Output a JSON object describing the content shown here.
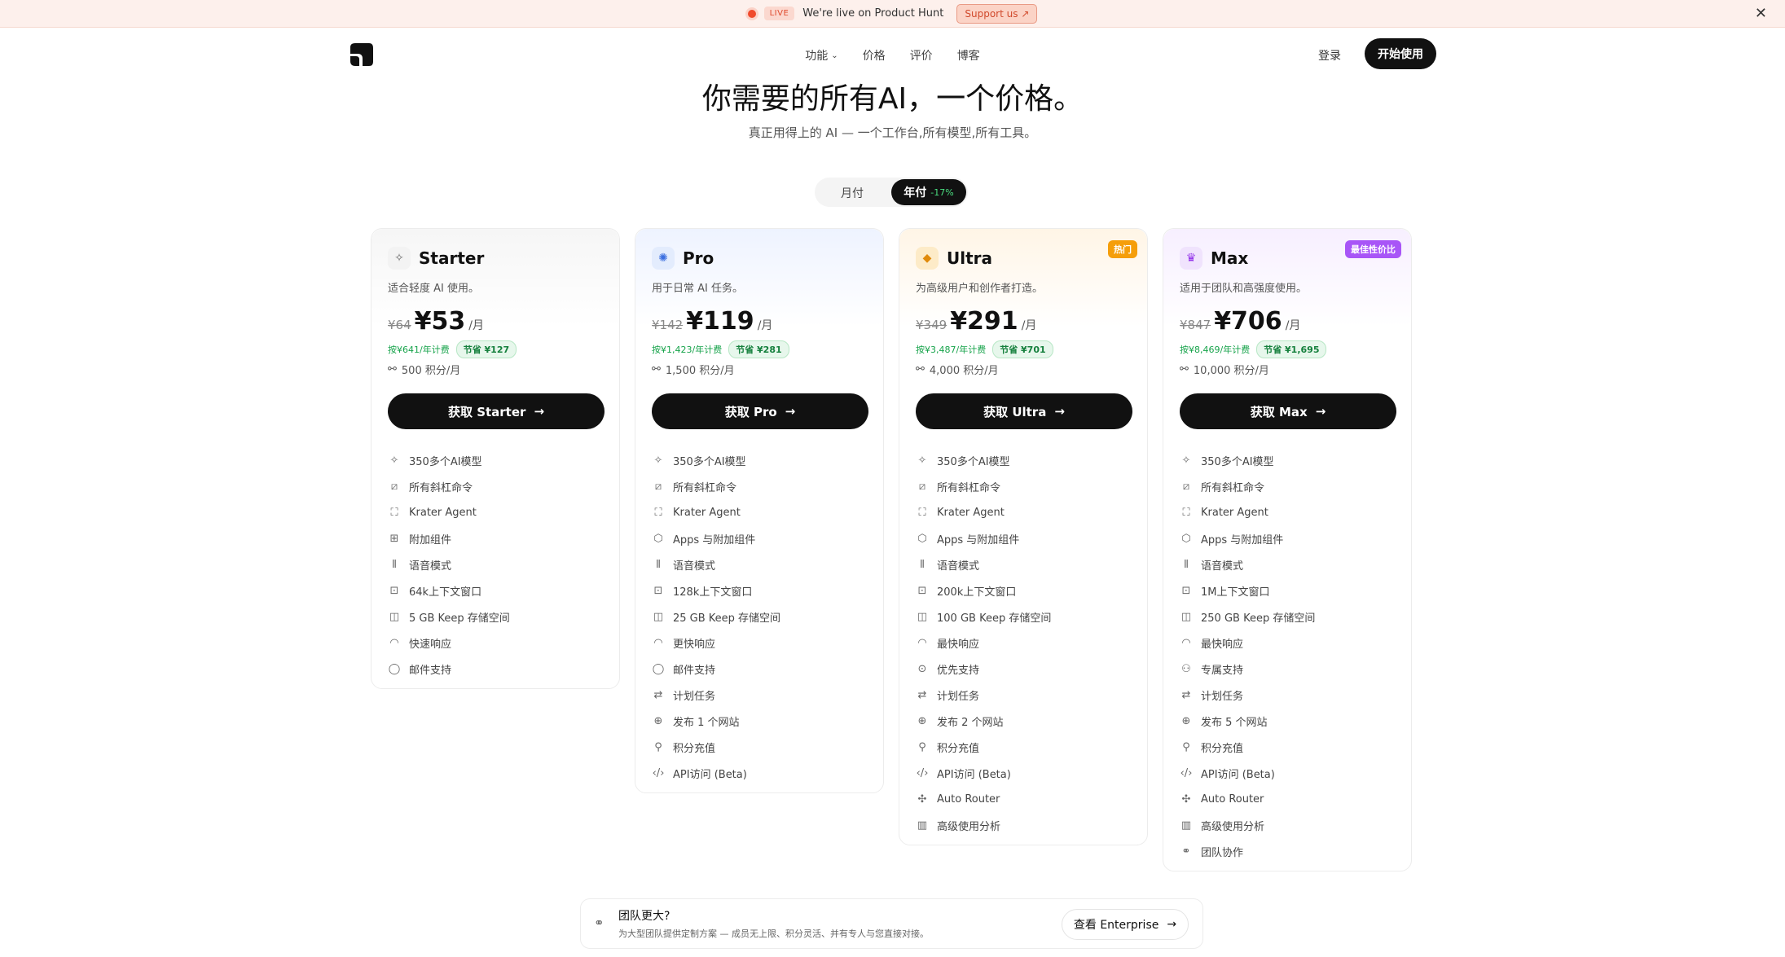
{
  "banner": {
    "live": "LIVE",
    "text": "We're live on Product Hunt",
    "support": "Support us",
    "close": "✕"
  },
  "nav": {
    "features": "功能",
    "pricing": "价格",
    "reviews": "评价",
    "blog": "博客",
    "login": "登录",
    "start": "开始使用"
  },
  "hero": {
    "title": "你需要的所有AI，一个价格。",
    "subtitle": "真正用得上的 AI — 一个工作台,所有模型,所有工具。"
  },
  "toggle": {
    "monthly": "月付",
    "yearly": "年付",
    "discount": "-17%"
  },
  "plans": [
    {
      "name": "Starter",
      "desc": "适合轻度 AI 使用。",
      "old": "¥64",
      "price": "¥53",
      "per": "/月",
      "yearly": "按¥641/年计费",
      "save": "节省 ¥127",
      "credits": "500 积分/月",
      "button": "获取 Starter",
      "badge": "",
      "accent": "#6b6b6b",
      "iconBg": "#f3f3f3",
      "glow": "#f6f6f6",
      "features": [
        {
          "icon": "sparkle-icon",
          "g": "✧",
          "label": "350多个AI模型"
        },
        {
          "icon": "slash-command-icon",
          "g": "⧄",
          "label": "所有斜杠命令"
        },
        {
          "icon": "agent-icon",
          "g": "⛶",
          "label": "Krater Agent"
        },
        {
          "icon": "widgets-icon",
          "g": "⊞",
          "label": "附加组件"
        },
        {
          "icon": "voice-icon",
          "g": "⫴",
          "label": "语音模式"
        },
        {
          "icon": "context-icon",
          "g": "⊡",
          "label": "64k上下文窗口"
        },
        {
          "icon": "storage-icon",
          "g": "◫",
          "label": "5 GB Keep 存储空间"
        },
        {
          "icon": "speed-icon",
          "g": "◠",
          "label": "快速响应"
        },
        {
          "icon": "chat-icon",
          "g": "◯",
          "label": "邮件支持"
        }
      ]
    },
    {
      "name": "Pro",
      "desc": "用于日常 AI 任务。",
      "old": "¥142",
      "price": "¥119",
      "per": "/月",
      "yearly": "按¥1,423/年计费",
      "save": "节省 ¥281",
      "credits": "1,500 积分/月",
      "button": "获取 Pro",
      "badge": "",
      "accent": "#3b6fe0",
      "iconBg": "#e3ecfd",
      "glow": "#eef3ff",
      "features": [
        {
          "icon": "sparkle-icon",
          "g": "✧",
          "label": "350多个AI模型"
        },
        {
          "icon": "slash-command-icon",
          "g": "⧄",
          "label": "所有斜杠命令"
        },
        {
          "icon": "agent-icon",
          "g": "⛶",
          "label": "Krater Agent"
        },
        {
          "icon": "cube-icon",
          "g": "⬡",
          "label": "Apps 与附加组件"
        },
        {
          "icon": "voice-icon",
          "g": "⫴",
          "label": "语音模式"
        },
        {
          "icon": "context-icon",
          "g": "⊡",
          "label": "128k上下文窗口"
        },
        {
          "icon": "storage-icon",
          "g": "◫",
          "label": "25 GB Keep 存储空间"
        },
        {
          "icon": "speed-icon",
          "g": "◠",
          "label": "更快响应"
        },
        {
          "icon": "chat-icon",
          "g": "◯",
          "label": "邮件支持"
        },
        {
          "icon": "repeat-icon",
          "g": "⇄",
          "label": "计划任务"
        },
        {
          "icon": "globe-icon",
          "g": "⊕",
          "label": "发布 1 个网站"
        },
        {
          "icon": "coins-icon",
          "g": "⚲",
          "label": "积分充值"
        },
        {
          "icon": "code-icon",
          "g": "‹/›",
          "label": "API访问 (Beta)"
        }
      ]
    },
    {
      "name": "Ultra",
      "desc": "为高级用户和创作者打造。",
      "old": "¥349",
      "price": "¥291",
      "per": "/月",
      "yearly": "按¥3,487/年计费",
      "save": "节省 ¥701",
      "credits": "4,000 积分/月",
      "button": "获取 Ultra",
      "badge": "热门",
      "badgeColor": "#f59e0b",
      "accent": "#e08a0b",
      "iconBg": "#fdebc8",
      "glow": "#fff5e6",
      "features": [
        {
          "icon": "sparkle-icon",
          "g": "✧",
          "label": "350多个AI模型"
        },
        {
          "icon": "slash-command-icon",
          "g": "⧄",
          "label": "所有斜杠命令"
        },
        {
          "icon": "agent-icon",
          "g": "⛶",
          "label": "Krater Agent"
        },
        {
          "icon": "cube-icon",
          "g": "⬡",
          "label": "Apps 与附加组件"
        },
        {
          "icon": "voice-icon",
          "g": "⫴",
          "label": "语音模式"
        },
        {
          "icon": "context-icon",
          "g": "⊡",
          "label": "200k上下文窗口"
        },
        {
          "icon": "storage-icon",
          "g": "◫",
          "label": "100 GB Keep 存储空间"
        },
        {
          "icon": "speed-icon",
          "g": "◠",
          "label": "最快响应"
        },
        {
          "icon": "priority-icon",
          "g": "⊙",
          "label": "优先支持"
        },
        {
          "icon": "repeat-icon",
          "g": "⇄",
          "label": "计划任务"
        },
        {
          "icon": "globe-icon",
          "g": "⊕",
          "label": "发布 2 个网站"
        },
        {
          "icon": "coins-icon",
          "g": "⚲",
          "label": "积分充值"
        },
        {
          "icon": "code-icon",
          "g": "‹/›",
          "label": "API访问 (Beta)"
        },
        {
          "icon": "router-icon",
          "g": "✣",
          "label": "Auto Router"
        },
        {
          "icon": "bar-chart-icon",
          "g": "▥",
          "label": "高级使用分析"
        }
      ]
    },
    {
      "name": "Max",
      "desc": "适用于团队和高强度使用。",
      "old": "¥847",
      "price": "¥706",
      "per": "/月",
      "yearly": "按¥8,469/年计费",
      "save": "节省 ¥1,695",
      "credits": "10,000 积分/月",
      "button": "获取 Max",
      "badge": "最佳性价比",
      "badgeColor": "#a855f7",
      "accent": "#9333ea",
      "iconBg": "#f0e3fd",
      "glow": "#f7efff",
      "features": [
        {
          "icon": "sparkle-icon",
          "g": "✧",
          "label": "350多个AI模型"
        },
        {
          "icon": "slash-command-icon",
          "g": "⧄",
          "label": "所有斜杠命令"
        },
        {
          "icon": "agent-icon",
          "g": "⛶",
          "label": "Krater Agent"
        },
        {
          "icon": "cube-icon",
          "g": "⬡",
          "label": "Apps 与附加组件"
        },
        {
          "icon": "voice-icon",
          "g": "⫴",
          "label": "语音模式"
        },
        {
          "icon": "context-icon",
          "g": "⊡",
          "label": "1M上下文窗口"
        },
        {
          "icon": "storage-icon",
          "g": "◫",
          "label": "250 GB Keep 存储空间"
        },
        {
          "icon": "speed-icon",
          "g": "◠",
          "label": "最快响应"
        },
        {
          "icon": "user-plus-icon",
          "g": "⚇",
          "label": "专属支持"
        },
        {
          "icon": "repeat-icon",
          "g": "⇄",
          "label": "计划任务"
        },
        {
          "icon": "globe-icon",
          "g": "⊕",
          "label": "发布 5 个网站"
        },
        {
          "icon": "coins-icon",
          "g": "⚲",
          "label": "积分充值"
        },
        {
          "icon": "code-icon",
          "g": "‹/›",
          "label": "API访问 (Beta)"
        },
        {
          "icon": "router-icon",
          "g": "✣",
          "label": "Auto Router"
        },
        {
          "icon": "bar-chart-icon",
          "g": "▥",
          "label": "高级使用分析"
        },
        {
          "icon": "team-icon",
          "g": "⚭",
          "label": "团队协作"
        }
      ]
    }
  ],
  "enterprise": {
    "title": "团队更大?",
    "desc": "为大型团队提供定制方案 — 成员无上限、积分灵活、并有专人与您直接对接。",
    "button": "查看 Enterprise"
  }
}
